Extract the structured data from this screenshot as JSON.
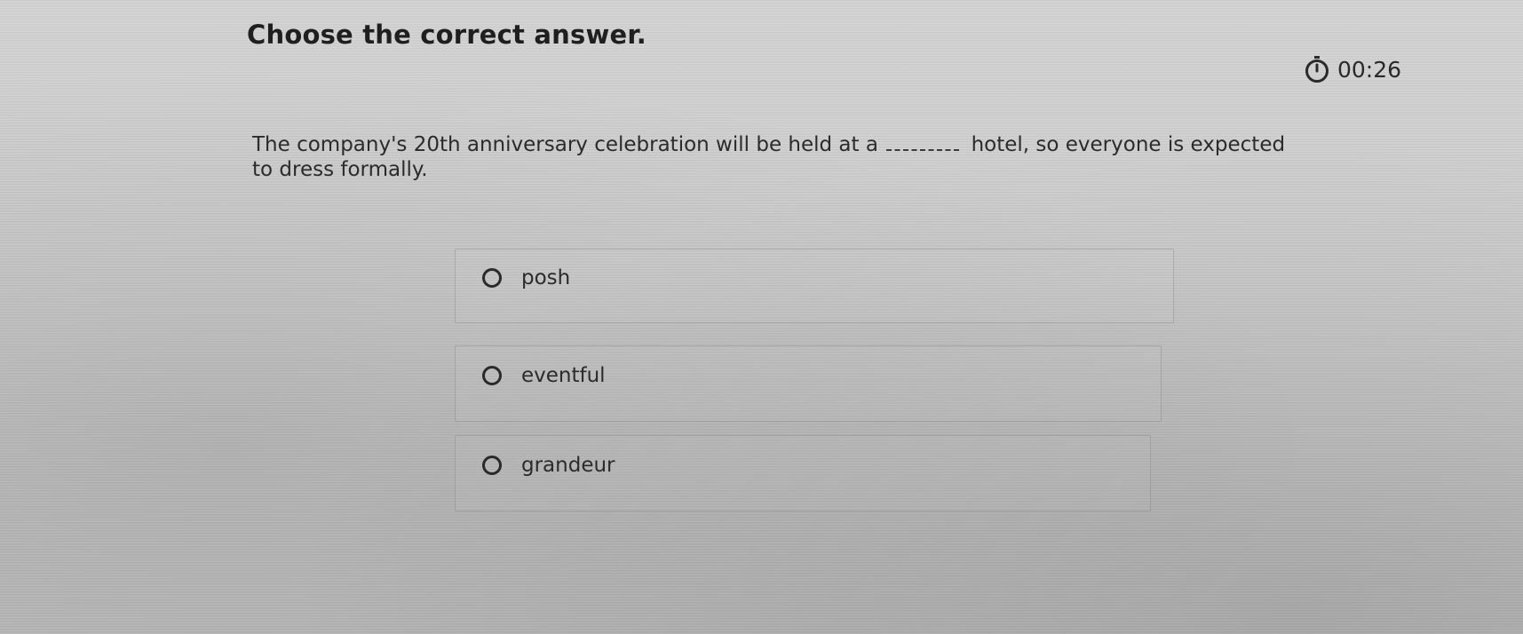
{
  "heading": "Choose the correct answer.",
  "timer": {
    "icon": "stopwatch-icon",
    "value": "00:26"
  },
  "question": {
    "before_blank": "The company's 20th anniversary celebration will be held at a",
    "after_blank": "hotel, so everyone is expected to dress formally."
  },
  "options": [
    {
      "label": "posh",
      "selected": false
    },
    {
      "label": "eventful",
      "selected": false
    },
    {
      "label": "grandeur",
      "selected": false
    }
  ],
  "colors": {
    "text": "#2a2a2a",
    "background": "#cdcdcd"
  }
}
